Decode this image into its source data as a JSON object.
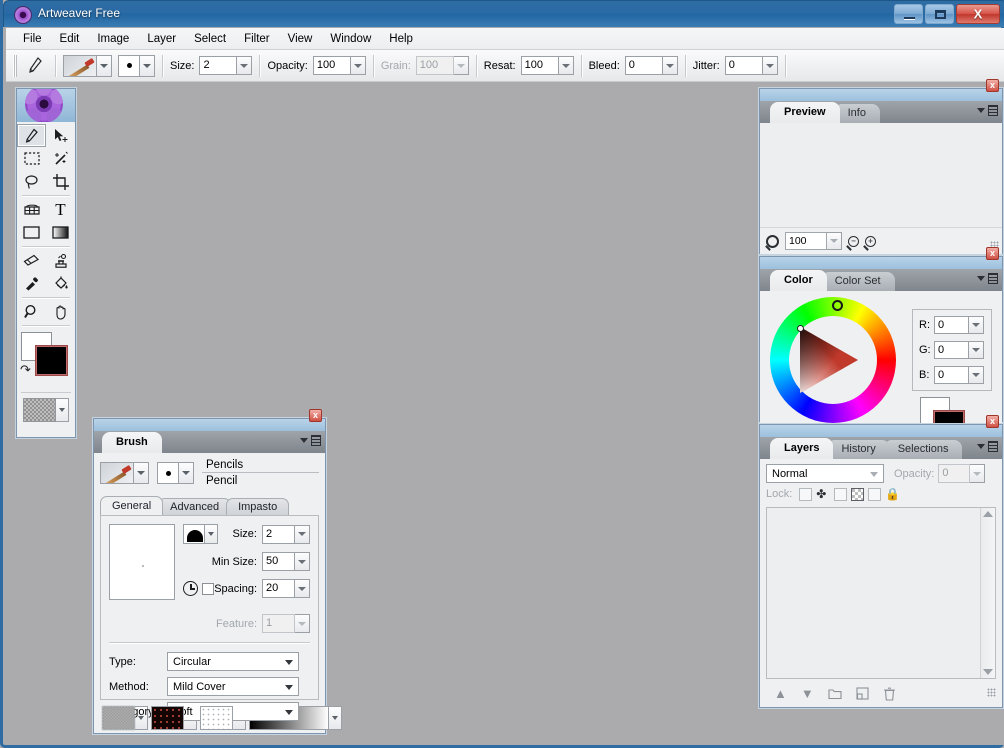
{
  "window": {
    "title": "Artweaver Free",
    "app_icon": "flower-icon",
    "controls": {
      "minimize": "minimize",
      "maximize": "maximize",
      "close": "X"
    }
  },
  "menubar": {
    "items": [
      "File",
      "Edit",
      "Image",
      "Layer",
      "Select",
      "Filter",
      "View",
      "Window",
      "Help"
    ]
  },
  "options_bar": {
    "tool_icon": "brush-tool-icon",
    "brush_preset_icon": "pencil-preset-icon",
    "brush_tip_icon": "round-tip-icon",
    "fields": [
      {
        "label": "Size:",
        "value": "2",
        "disabled": false
      },
      {
        "label": "Opacity:",
        "value": "100",
        "disabled": false
      },
      {
        "label": "Grain:",
        "value": "100",
        "disabled": true
      },
      {
        "label": "Resat:",
        "value": "100",
        "disabled": false
      },
      {
        "label": "Bleed:",
        "value": "0",
        "disabled": false
      },
      {
        "label": "Jitter:",
        "value": "0",
        "disabled": false
      }
    ]
  },
  "toolbox": {
    "tools": [
      {
        "name": "brush",
        "glyph": "✎",
        "active": true
      },
      {
        "name": "move",
        "glyph": "➤",
        "active": false
      },
      {
        "name": "rect-select",
        "glyph": "⬚",
        "active": false
      },
      {
        "name": "magic-wand",
        "glyph": "✹",
        "active": false
      },
      {
        "name": "lasso",
        "glyph": "○",
        "active": false
      },
      {
        "name": "crop",
        "glyph": "⌗",
        "active": false
      },
      {
        "name": "perspective",
        "glyph": "▦",
        "active": false
      },
      {
        "name": "text",
        "glyph": "T",
        "active": false
      },
      {
        "name": "shape",
        "glyph": "▭",
        "active": false
      },
      {
        "name": "gradient",
        "glyph": "▨",
        "active": false
      },
      {
        "name": "eraser",
        "glyph": "▱",
        "active": false
      },
      {
        "name": "clone-stamp",
        "glyph": "⚒",
        "active": false
      },
      {
        "name": "eyedropper",
        "glyph": "✒",
        "active": false
      },
      {
        "name": "paint-bucket",
        "glyph": "◢",
        "active": false
      },
      {
        "name": "zoom",
        "glyph": "⚲",
        "active": false
      },
      {
        "name": "pan-hand",
        "glyph": "✋",
        "active": false
      }
    ],
    "foreground_color": "#000000",
    "background_color": "#ffffff",
    "texture_swatch": "paper-texture"
  },
  "brush_panel": {
    "tab": "Brush",
    "brush_group": "Pencils",
    "brush_name": "Pencil",
    "subtabs": [
      {
        "label": "General",
        "active": true
      },
      {
        "label": "Advanced",
        "active": false
      },
      {
        "label": "Impasto",
        "active": false
      }
    ],
    "fields": [
      {
        "label": "Size:",
        "value": "2",
        "disabled": false
      },
      {
        "label": "Min Size:",
        "value": "50",
        "disabled": false
      },
      {
        "label": "Spacing:",
        "value": "20",
        "disabled": false
      },
      {
        "label": "Feature:",
        "value": "1",
        "disabled": true
      }
    ],
    "selects": [
      {
        "label": "Type:",
        "value": "Circular"
      },
      {
        "label": "Method:",
        "value": "Mild Cover"
      },
      {
        "label": "Category:",
        "value": "Soft"
      }
    ],
    "footer_swatches": [
      "paper-texture-swatch",
      "pattern-swatch",
      "dots-swatch",
      "gradient-swatch"
    ]
  },
  "preview_panel": {
    "tabs": [
      {
        "label": "Preview",
        "active": true
      },
      {
        "label": "Info",
        "active": false
      }
    ],
    "zoom_value": "100",
    "zoom_icons": [
      "magnifier-icon",
      "zoom-out-icon",
      "zoom-in-icon"
    ]
  },
  "color_panel": {
    "tabs": [
      {
        "label": "Color",
        "active": true
      },
      {
        "label": "Color Set",
        "active": false
      }
    ],
    "channels": [
      {
        "label": "R:",
        "value": "0"
      },
      {
        "label": "G:",
        "value": "0"
      },
      {
        "label": "B:",
        "value": "0"
      }
    ],
    "foreground_color": "#000000",
    "background_color": "#ffffff",
    "wheel_accent": "#c0392b"
  },
  "layers_panel": {
    "tabs": [
      {
        "label": "Layers",
        "active": true
      },
      {
        "label": "History",
        "active": false
      },
      {
        "label": "Selections",
        "active": false
      }
    ],
    "blend_mode": "Normal",
    "opacity_label": "Opacity:",
    "opacity_value": "0",
    "lock_label": "Lock:",
    "lock_icons": [
      "move-lock-icon",
      "transparency-lock-icon",
      "all-lock-icon"
    ],
    "layers": [],
    "footer_buttons": [
      "raise-layer-icon",
      "lower-layer-icon",
      "new-group-icon",
      "new-layer-icon",
      "delete-layer-icon"
    ]
  }
}
